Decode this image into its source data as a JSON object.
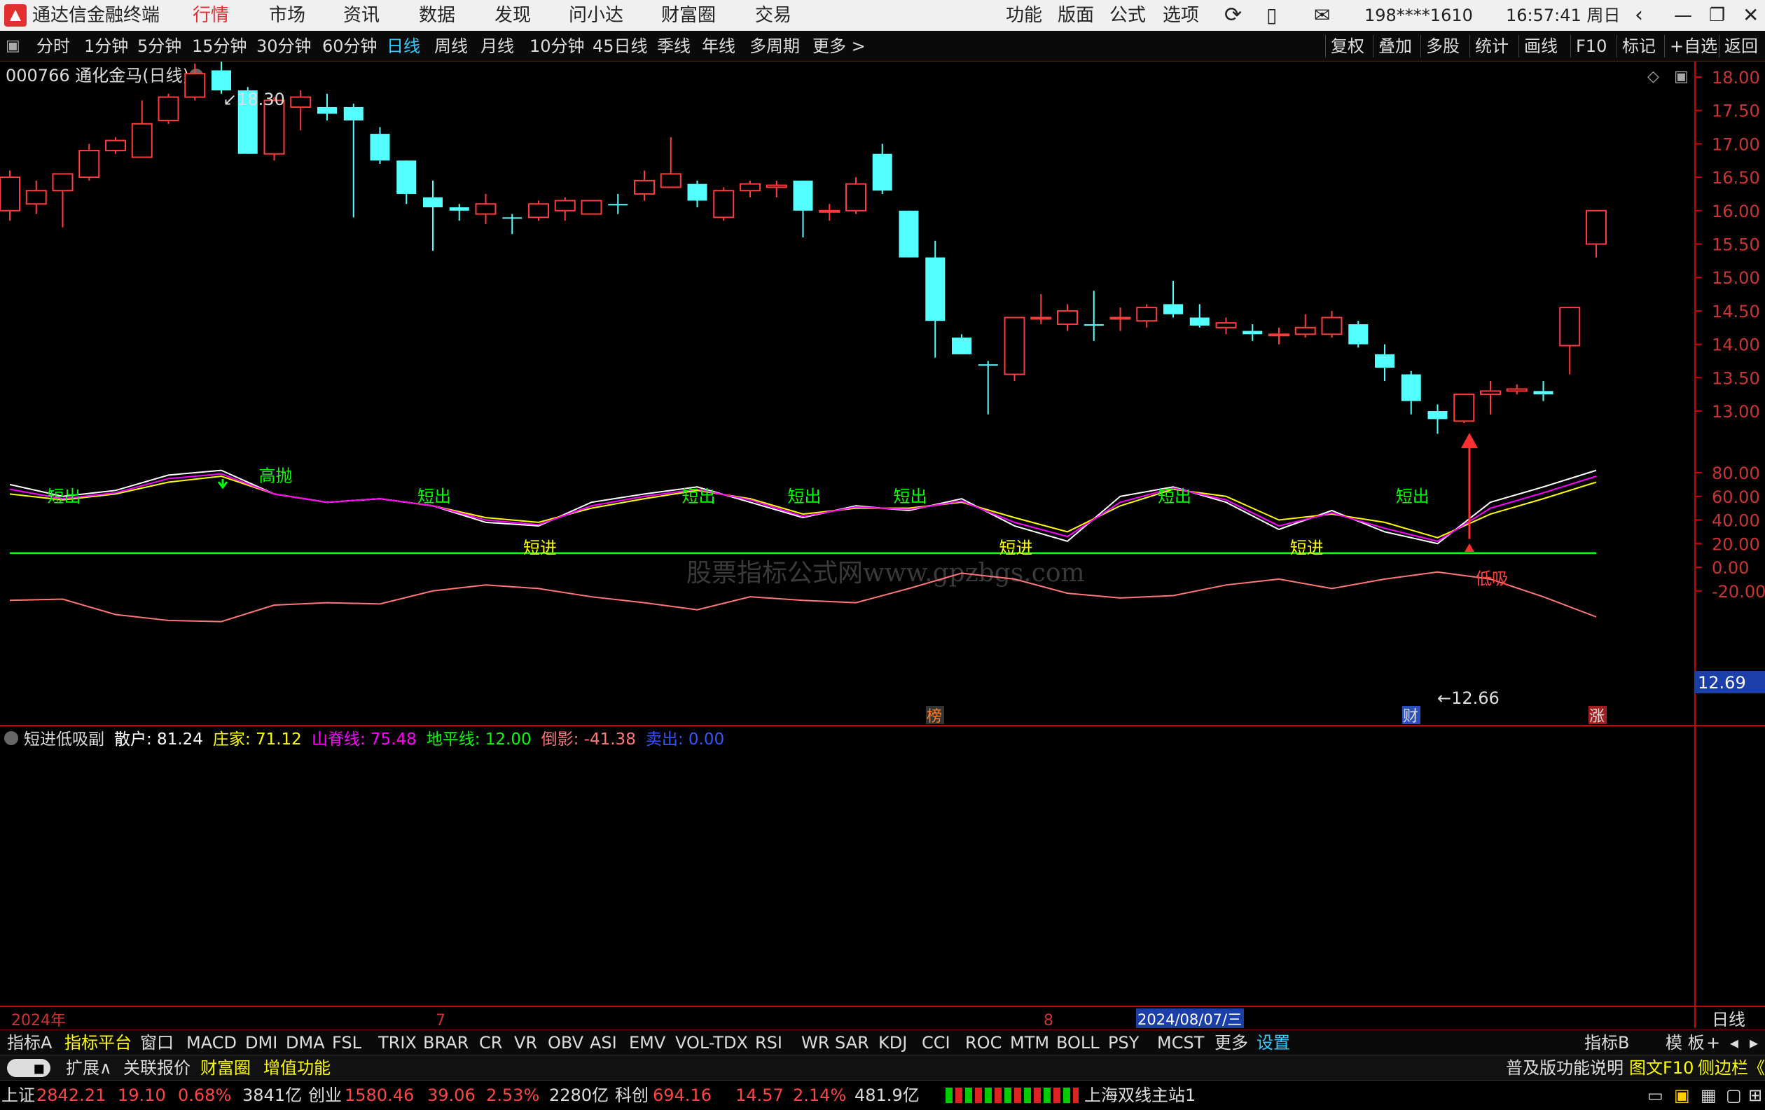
{
  "window": {
    "app_title": "通达信金融终端",
    "nav": [
      "行情",
      "市场",
      "资讯",
      "数据",
      "发现",
      "问小达",
      "财富圈",
      "交易"
    ],
    "right_menu": [
      "功能",
      "版面",
      "公式",
      "选项"
    ],
    "account": "198****1610",
    "clock": "16:57:41 周日",
    "brand_color": "#e23030"
  },
  "toolbar": {
    "periods": [
      "分时",
      "1分钟",
      "5分钟",
      "15分钟",
      "30分钟",
      "60分钟",
      "日线",
      "周线",
      "月线",
      "10分钟",
      "45日线",
      "季线",
      "年线",
      "多周期",
      "更多 >"
    ],
    "active_period": "日线",
    "right": [
      "复权",
      "叠加",
      "多股",
      "统计",
      "画线",
      "F10",
      "标记",
      "+自选",
      "返回"
    ]
  },
  "main_chart": {
    "stock_title": "000766 通化金马(日线)",
    "high_label": "18.30",
    "low_label": "12.66",
    "current_price": "12.69",
    "watermark": "股票指标公式网www.gpzbgs.com",
    "price_axis": [
      "18.00",
      "17.50",
      "17.00",
      "16.50",
      "16.00",
      "15.50",
      "15.00",
      "14.50",
      "14.00",
      "13.50",
      "13.00"
    ],
    "markers": [
      {
        "text": "榜",
        "color": "#ff7f27"
      },
      {
        "text": "财",
        "color": "#ddd"
      },
      {
        "text": "涨",
        "color": "#ddd"
      }
    ]
  },
  "chart_data": [
    {
      "type": "candlestick",
      "title": "000766 通化金马(日线)",
      "ylim": [
        12.5,
        18.5
      ],
      "candles": [
        {
          "o": 16.0,
          "h": 16.6,
          "l": 15.85,
          "c": 16.5
        },
        {
          "o": 16.1,
          "h": 16.45,
          "l": 15.95,
          "c": 16.3
        },
        {
          "o": 16.3,
          "h": 16.55,
          "l": 15.75,
          "c": 16.55
        },
        {
          "o": 16.5,
          "h": 17.0,
          "l": 16.45,
          "c": 16.9
        },
        {
          "o": 16.9,
          "h": 17.1,
          "l": 16.85,
          "c": 17.05
        },
        {
          "o": 16.8,
          "h": 17.65,
          "l": 16.8,
          "c": 17.3
        },
        {
          "o": 17.35,
          "h": 17.75,
          "l": 17.3,
          "c": 17.7
        },
        {
          "o": 17.7,
          "h": 18.2,
          "l": 17.65,
          "c": 18.05
        },
        {
          "o": 18.1,
          "h": 18.3,
          "l": 17.75,
          "c": 17.8
        },
        {
          "o": 17.8,
          "h": 17.85,
          "l": 16.85,
          "c": 16.85
        },
        {
          "o": 16.85,
          "h": 17.7,
          "l": 16.75,
          "c": 17.65
        },
        {
          "o": 17.55,
          "h": 17.8,
          "l": 17.2,
          "c": 17.7
        },
        {
          "o": 17.55,
          "h": 17.75,
          "l": 17.35,
          "c": 17.45
        },
        {
          "o": 17.55,
          "h": 17.6,
          "l": 15.9,
          "c": 17.35
        },
        {
          "o": 17.15,
          "h": 17.25,
          "l": 16.7,
          "c": 16.75
        },
        {
          "o": 16.75,
          "h": 16.75,
          "l": 16.1,
          "c": 16.25
        },
        {
          "o": 16.2,
          "h": 16.45,
          "l": 15.4,
          "c": 16.05
        },
        {
          "o": 16.05,
          "h": 16.1,
          "l": 15.85,
          "c": 16.0
        },
        {
          "o": 15.95,
          "h": 16.25,
          "l": 15.8,
          "c": 16.1
        },
        {
          "o": 15.9,
          "h": 15.95,
          "l": 15.65,
          "c": 15.88
        },
        {
          "o": 15.9,
          "h": 16.15,
          "l": 15.85,
          "c": 16.1
        },
        {
          "o": 16.0,
          "h": 16.2,
          "l": 15.85,
          "c": 16.15
        },
        {
          "o": 15.95,
          "h": 16.15,
          "l": 15.95,
          "c": 16.15
        },
        {
          "o": 16.1,
          "h": 16.25,
          "l": 15.95,
          "c": 16.08
        },
        {
          "o": 16.25,
          "h": 16.6,
          "l": 16.15,
          "c": 16.45
        },
        {
          "o": 16.35,
          "h": 17.1,
          "l": 16.35,
          "c": 16.55
        },
        {
          "o": 16.4,
          "h": 16.45,
          "l": 16.05,
          "c": 16.15
        },
        {
          "o": 15.9,
          "h": 16.35,
          "l": 15.85,
          "c": 16.3
        },
        {
          "o": 16.3,
          "h": 16.45,
          "l": 16.2,
          "c": 16.4
        },
        {
          "o": 16.35,
          "h": 16.45,
          "l": 16.2,
          "c": 16.38
        },
        {
          "o": 16.45,
          "h": 16.45,
          "l": 15.6,
          "c": 16.0
        },
        {
          "o": 16.0,
          "h": 16.1,
          "l": 15.85,
          "c": 16.0
        },
        {
          "o": 16.0,
          "h": 16.5,
          "l": 15.95,
          "c": 16.4
        },
        {
          "o": 16.85,
          "h": 17.0,
          "l": 16.25,
          "c": 16.3
        },
        {
          "o": 16.0,
          "h": 16.0,
          "l": 15.3,
          "c": 15.3
        },
        {
          "o": 15.3,
          "h": 15.55,
          "l": 13.8,
          "c": 14.35
        },
        {
          "o": 14.1,
          "h": 14.15,
          "l": 13.85,
          "c": 13.85
        },
        {
          "o": 13.7,
          "h": 13.75,
          "l": 12.95,
          "c": 13.68
        },
        {
          "o": 13.55,
          "h": 14.4,
          "l": 13.45,
          "c": 14.4
        },
        {
          "o": 14.38,
          "h": 14.75,
          "l": 14.3,
          "c": 14.4
        },
        {
          "o": 14.3,
          "h": 14.6,
          "l": 14.2,
          "c": 14.5
        },
        {
          "o": 14.3,
          "h": 14.8,
          "l": 14.05,
          "c": 14.28
        },
        {
          "o": 14.4,
          "h": 14.55,
          "l": 14.2,
          "c": 14.4
        },
        {
          "o": 14.35,
          "h": 14.6,
          "l": 14.25,
          "c": 14.55
        },
        {
          "o": 14.6,
          "h": 14.95,
          "l": 14.4,
          "c": 14.45
        },
        {
          "o": 14.4,
          "h": 14.6,
          "l": 14.25,
          "c": 14.28
        },
        {
          "o": 14.25,
          "h": 14.4,
          "l": 14.15,
          "c": 14.32
        },
        {
          "o": 14.2,
          "h": 14.3,
          "l": 14.05,
          "c": 14.15
        },
        {
          "o": 14.15,
          "h": 14.25,
          "l": 14.0,
          "c": 14.15
        },
        {
          "o": 14.15,
          "h": 14.45,
          "l": 14.1,
          "c": 14.25
        },
        {
          "o": 14.15,
          "h": 14.5,
          "l": 14.1,
          "c": 14.4
        },
        {
          "o": 14.3,
          "h": 14.35,
          "l": 13.95,
          "c": 14.0
        },
        {
          "o": 13.85,
          "h": 14.0,
          "l": 13.45,
          "c": 13.65
        },
        {
          "o": 13.55,
          "h": 13.6,
          "l": 12.95,
          "c": 13.15
        },
        {
          "o": 13.0,
          "h": 13.1,
          "l": 12.66,
          "c": 12.88
        },
        {
          "o": 12.85,
          "h": 13.25,
          "l": 12.82,
          "c": 13.25
        },
        {
          "o": 13.25,
          "h": 13.45,
          "l": 12.95,
          "c": 13.3
        },
        {
          "o": 13.3,
          "h": 13.4,
          "l": 13.25,
          "c": 13.33
        },
        {
          "o": 13.3,
          "h": 13.45,
          "l": 13.15,
          "c": 13.25
        },
        {
          "o": 13.98,
          "h": 14.55,
          "l": 13.55,
          "c": 14.55
        },
        {
          "o": 15.5,
          "h": 16.0,
          "l": 15.3,
          "c": 16.0
        }
      ]
    },
    {
      "type": "line",
      "title": "短进低吸副",
      "ylim": [
        -45,
        95
      ],
      "y_ticks": [
        "80.00",
        "60.00",
        "40.00",
        "20.00",
        "0.00",
        "-20.00"
      ],
      "x": [
        1,
        3,
        5,
        7,
        9,
        11,
        13,
        15,
        17,
        19,
        21,
        23,
        25,
        27,
        29,
        31,
        33,
        35,
        37,
        39,
        41,
        43,
        45,
        47,
        49,
        51,
        53,
        55,
        57,
        59,
        61
      ],
      "series": [
        {
          "name": "散户",
          "color": "#ffffff",
          "values": [
            70,
            60,
            65,
            78,
            82,
            62,
            55,
            58,
            52,
            38,
            35,
            55,
            62,
            68,
            55,
            42,
            52,
            48,
            58,
            35,
            22,
            60,
            68,
            55,
            32,
            48,
            30,
            20,
            55,
            68,
            82
          ]
        },
        {
          "name": "庄家",
          "color": "#ffff00",
          "values": [
            62,
            57,
            62,
            72,
            77,
            62,
            55,
            58,
            52,
            42,
            38,
            50,
            58,
            65,
            58,
            45,
            50,
            50,
            55,
            42,
            30,
            52,
            66,
            60,
            40,
            45,
            38,
            25,
            45,
            58,
            72
          ]
        },
        {
          "name": "山脊线",
          "color": "#ff00ff",
          "values": [
            66,
            58,
            63,
            75,
            79,
            62,
            55,
            58,
            52,
            40,
            36,
            52,
            60,
            66,
            57,
            43,
            51,
            49,
            56,
            38,
            26,
            55,
            67,
            57,
            35,
            46,
            33,
            22,
            50,
            63,
            77
          ]
        },
        {
          "name": "地平线",
          "color": "#00ff00",
          "values": [
            12,
            12,
            12,
            12,
            12,
            12,
            12,
            12,
            12,
            12,
            12,
            12,
            12,
            12,
            12,
            12,
            12,
            12,
            12,
            12,
            12,
            12,
            12,
            12,
            12,
            12,
            12,
            12,
            12,
            12,
            12
          ]
        },
        {
          "name": "倒影",
          "color": "#ff7777",
          "values": [
            -28,
            -27,
            -40,
            -45,
            -46,
            -32,
            -30,
            -31,
            -20,
            -15,
            -18,
            -25,
            -30,
            -36,
            -25,
            -28,
            -30,
            -18,
            -5,
            -10,
            -22,
            -26,
            -24,
            -15,
            -10,
            -18,
            -10,
            -4,
            -10,
            -25,
            -42
          ]
        }
      ],
      "annotations": [
        {
          "text": "短出",
          "x": 3
        },
        {
          "text": "高抛",
          "x": 11
        },
        {
          "text": "短出",
          "x": 17
        },
        {
          "text": "短进",
          "x": 21
        },
        {
          "text": "短出",
          "x": 27
        },
        {
          "text": "短出",
          "x": 31
        },
        {
          "text": "短出",
          "x": 35
        },
        {
          "text": "短进",
          "x": 39
        },
        {
          "text": "短出",
          "x": 45
        },
        {
          "text": "短进",
          "x": 50
        },
        {
          "text": "短出",
          "x": 54
        },
        {
          "text": "低吸",
          "x": 57
        }
      ]
    }
  ],
  "sub_chart": {
    "legend": [
      {
        "label": "短进低吸副",
        "color": "#dddddd"
      },
      {
        "label": "散户: 81.24",
        "color": "#ffffff"
      },
      {
        "label": "庄家: 71.12",
        "color": "#ffff00"
      },
      {
        "label": "山脊线: 75.48",
        "color": "#ff00ff"
      },
      {
        "label": "地平线: 12.00",
        "color": "#00ff00"
      },
      {
        "label": "倒影: -41.38",
        "color": "#ff7777"
      },
      {
        "label": "卖出: 0.00",
        "color": "#3355ff"
      }
    ]
  },
  "date_axis": {
    "start": "2024年",
    "m7": "7",
    "m8": "8",
    "cursor_date": "2024/08/07/三",
    "right_label": "日线"
  },
  "indicator_tabs": [
    "指标A",
    "指标平台",
    "窗口",
    "MACD",
    "DMI",
    "DMA",
    "FSL",
    "TRIX",
    "BRAR",
    "CR",
    "VR",
    "OBV",
    "ASI",
    "EMV",
    "VOL-TDX",
    "RSI",
    "WR",
    "SAR",
    "KDJ",
    "CCI",
    "ROC",
    "MTM",
    "BOLL",
    "PSY",
    "MCST",
    "更多",
    "设置"
  ],
  "indicator_right": [
    "指标B",
    "模 板"
  ],
  "ext_bar": {
    "items": [
      "扩展∧",
      "关联报价",
      "财富圈",
      "增值功能"
    ],
    "right": "普及版功能说明",
    "f10": "图文F10",
    "side": "侧边栏《"
  },
  "status": [
    {
      "name": "上证",
      "val": "2842.21",
      "chg": "19.10",
      "pct": "0.68%",
      "amt": "3841亿"
    },
    {
      "name": "创业",
      "val": "1580.46",
      "chg": "39.06",
      "pct": "2.53%",
      "amt": "2280亿"
    },
    {
      "name": "科创",
      "val": "694.16",
      "chg": "14.57",
      "pct": "2.14%",
      "amt": "481.9亿"
    }
  ],
  "server": "上海双线主站1"
}
